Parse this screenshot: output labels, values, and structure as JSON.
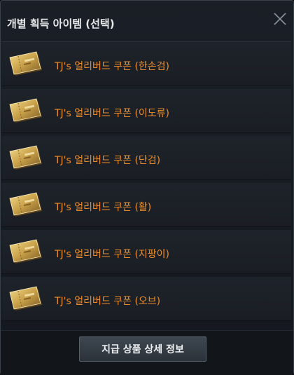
{
  "dialog": {
    "title": "개별 획득 아이템 (선택)",
    "close_icon": "close-icon"
  },
  "items": [
    {
      "label": "TJ's 얼리버드 쿠폰 (한손검)",
      "icon": "coupon-icon"
    },
    {
      "label": "TJ's 얼리버드 쿠폰 (이도류)",
      "icon": "coupon-icon"
    },
    {
      "label": "TJ's 얼리버드 쿠폰 (단검)",
      "icon": "coupon-icon"
    },
    {
      "label": "TJ's 얼리버드 쿠폰 (활)",
      "icon": "coupon-icon"
    },
    {
      "label": "TJ's 얼리버드 쿠폰 (지팡이)",
      "icon": "coupon-icon"
    },
    {
      "label": "TJ's 얼리버드 쿠폰 (오브)",
      "icon": "coupon-icon"
    }
  ],
  "footer": {
    "detail_button_label": "지급 상품 상세 정보"
  },
  "colors": {
    "item_label": "#ec8d2a",
    "background": "#1a1f26",
    "coupon_gold": "#c9a14a"
  }
}
